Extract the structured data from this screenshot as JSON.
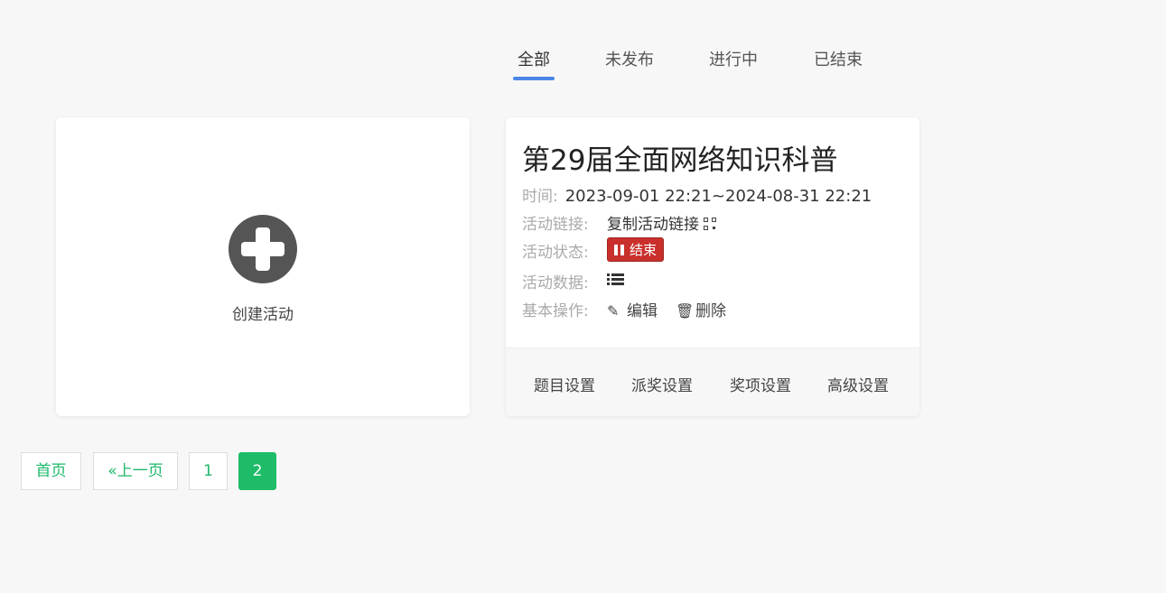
{
  "tabs": [
    {
      "label": "全部",
      "active": true
    },
    {
      "label": "未发布",
      "active": false
    },
    {
      "label": "进行中",
      "active": false
    },
    {
      "label": "已结束",
      "active": false
    }
  ],
  "create_card": {
    "icon": "plus-circle-icon",
    "label": "创建活动"
  },
  "event": {
    "title": "第29届全面网络知识科普",
    "time_label": "时间:",
    "time_value": "2023-09-01 22:21~2024-08-31 22:21",
    "link_label": "活动链接:",
    "link_value": "复制活动链接",
    "link_icon": "qrcode-icon",
    "status_label": "活动状态:",
    "status_value": "结束",
    "status_icon": "pause-icon",
    "status_color": "#c9302c",
    "data_label": "活动数据:",
    "data_icon": "list-icon",
    "ops_label": "基本操作:",
    "edit_label": "编辑",
    "delete_label": "删除",
    "footer": [
      "题目设置",
      "派奖设置",
      "奖项设置",
      "高级设置"
    ]
  },
  "pagination": {
    "first": "首页",
    "prev": "«上一页",
    "pages": [
      "1",
      "2"
    ],
    "current": "2",
    "accent": "#1ebc68"
  }
}
